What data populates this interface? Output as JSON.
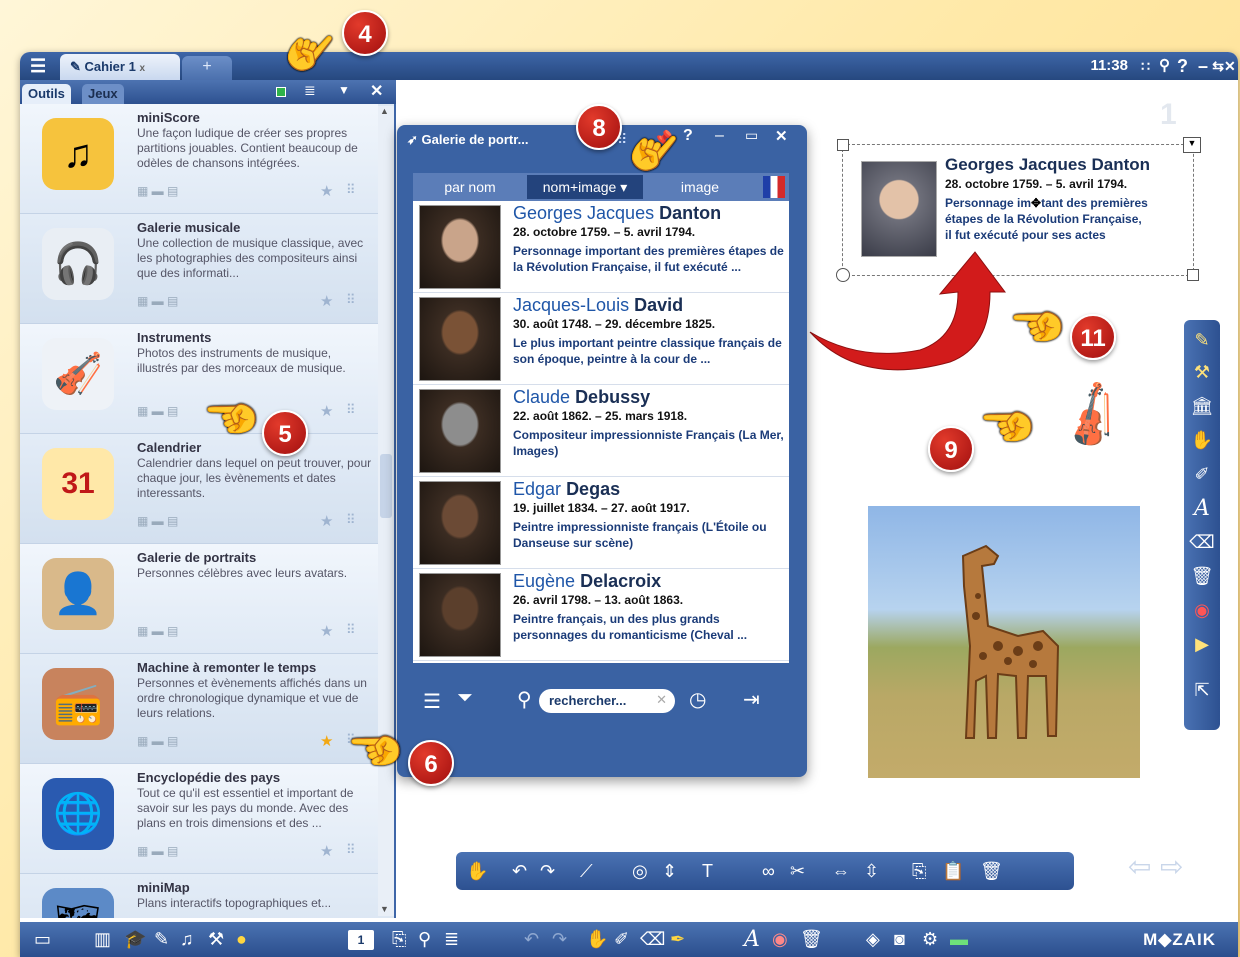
{
  "titlebar": {
    "tab_label": "Cahier 1",
    "tab_close": "x",
    "add_tab": "+",
    "time": "11:38",
    "controls": [
      "∷",
      "⚲",
      "?",
      "–",
      "⇆",
      "✕"
    ]
  },
  "sidebar": {
    "tabs": [
      "Outils",
      "Jeux"
    ],
    "items": [
      {
        "title": "miniScore",
        "desc": "Une façon ludique de créer ses propres partitions jouables. Contient beaucoup de odèles de chansons intégrées.",
        "color": "#f6c33d",
        "glyph": "♫",
        "starred": false
      },
      {
        "title": "Galerie musicale",
        "desc": "Une collection de musique classique, avec les photographies des compositeurs ainsi que des informati...",
        "color": "#e9eef4",
        "glyph": "🎧",
        "starred": false
      },
      {
        "title": "Instruments",
        "desc": "Photos des instruments de musique, illustrés par des morceaux de musique.",
        "color": "#eef2f7",
        "glyph": "🎻",
        "starred": false
      },
      {
        "title": "Calendrier",
        "desc": "Calendrier dans lequel on peut trouver, pour chaque jour, les èvènements et dates interessants.",
        "color": "#ffe8a8",
        "glyph": "31",
        "starred": false
      },
      {
        "title": "Galerie de portraits",
        "desc": "Personnes célèbres avec leurs avatars.",
        "color": "#d9b98a",
        "glyph": "👤",
        "starred": false
      },
      {
        "title": "Machine à remonter le temps",
        "desc": "Personnes et èvènements affichés dans un ordre chronologique dynamique et vue de leurs relations.",
        "color": "#c8835d",
        "glyph": "📻",
        "starred": true
      },
      {
        "title": "Encyclopédie des pays",
        "desc": "Tout ce qu'il est essentiel et important de savoir sur les pays du monde. Avec des plans en trois dimensions et des ...",
        "color": "#2a5ab0",
        "glyph": "🌐",
        "starred": false
      },
      {
        "title": "miniMap",
        "desc": "Plans interactifs topographiques et...",
        "color": "#5c8ac7",
        "glyph": "🗺",
        "starred": false
      }
    ]
  },
  "gallery": {
    "title": "Galerie de portr...",
    "views": [
      "par nom",
      "nom+image ▾",
      "image"
    ],
    "search_placeholder": "rechercher...",
    "people": [
      {
        "first": "Georges Jacques",
        "last": "Danton",
        "dates": "28. octobre 1759. – 5. avril 1794.",
        "desc": "Personnage important des premières étapes de la Révolution Française, il fut exécuté ...",
        "tone": "#c9a48a"
      },
      {
        "first": "Jacques-Louis",
        "last": "David",
        "dates": "30. août 1748. – 29. décembre 1825.",
        "desc": "Le plus important peintre classique français de son époque, peintre à la cour de ...",
        "tone": "#7a5236"
      },
      {
        "first": "Claude",
        "last": "Debussy",
        "dates": "22. août 1862. – 25. mars 1918.",
        "desc": "Compositeur impressionniste Français (La Mer, Images)",
        "tone": "#8d8d8d"
      },
      {
        "first": "Edgar",
        "last": "Degas",
        "dates": "19. juillet 1834. – 27. août 1917.",
        "desc": "Peintre impressionniste français (L'Étoile ou Danseuse sur scène)",
        "tone": "#6b4a35"
      },
      {
        "first": "Eugène",
        "last": "Delacroix",
        "dates": "26. avril 1798. – 13. août 1863.",
        "desc": "Peintre français, un des plus grands personnages du romanticisme (Cheval ...",
        "tone": "#5b3f2c"
      }
    ]
  },
  "canvas": {
    "page_number": "1",
    "card": {
      "name": "Georges Jacques Danton",
      "dates": "28. octobre 1759. – 5. avril 1794.",
      "line1": "Personnage im",
      "line1b": "tant des premières",
      "line2": "étapes de la Révolution Française,",
      "line3": "il fut exécuté pour ses actes"
    }
  },
  "callouts": [
    "4",
    "5",
    "6",
    "8",
    "9",
    "11"
  ],
  "bottombar": {
    "page": "1",
    "brand": "M◆ZAIK"
  },
  "colors": {
    "accent": "#3a62a3",
    "badge": "#c41e1e",
    "link": "#1f56a8"
  }
}
